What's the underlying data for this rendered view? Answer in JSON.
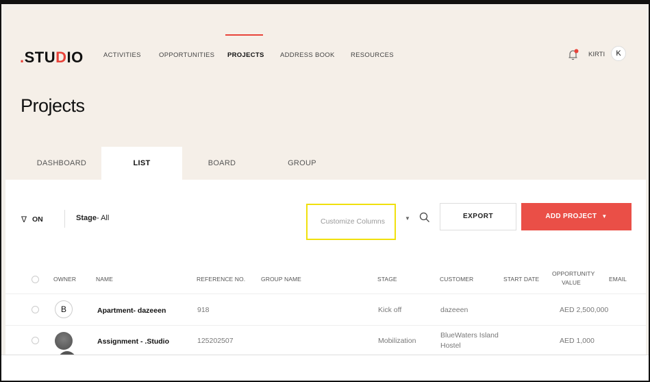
{
  "app": {
    "logo": ".STUDIO"
  },
  "nav": {
    "items": [
      "ACTIVITIES",
      "OPPORTUNITIES",
      "PROJECTS",
      "ADDRESS BOOK",
      "RESOURCES"
    ],
    "active": "PROJECTS"
  },
  "user": {
    "name": "KIRTI",
    "initial": "K"
  },
  "page": {
    "title": "Projects"
  },
  "tabs": [
    "DASHBOARD",
    "LIST",
    "BOARD",
    "GROUP"
  ],
  "toolbar": {
    "filter_label": "ON",
    "stage_label": "Stage",
    "stage_value": "- All",
    "customize_label": "Customize Columns",
    "export_label": "EXPORT",
    "add_label": "ADD PROJECT"
  },
  "table": {
    "headers": {
      "owner": "OWNER",
      "name": "NAME",
      "reference": "REFERENCE NO.",
      "group": "GROUP NAME",
      "stage": "STAGE",
      "customer": "CUSTOMER",
      "start_date": "START DATE",
      "value_line1": "OPPORTUNITY",
      "value_line2": "VALUE",
      "email": "EMAIL"
    },
    "rows": [
      {
        "owner_initial": "B",
        "name": "Apartment- dazeeen",
        "reference": "918",
        "group": "",
        "stage": "Kick off",
        "customer": "dazeeen",
        "start_date": "",
        "value": "AED 2,500,000"
      },
      {
        "owner_initial": "",
        "name": "Assignment - .Studio",
        "reference": "125202507",
        "group": "",
        "stage": "Mobilization",
        "customer_line1": "BlueWaters Island",
        "customer_line2": "Hostel",
        "start_date": "",
        "value": "AED 1,000"
      }
    ]
  },
  "colors": {
    "accent": "#ea4f47",
    "highlight": "#f0e00c",
    "header_bg": "#f5efe8"
  },
  "icons": [
    "filter-icon",
    "search-icon",
    "bell-icon",
    "caret-down-icon"
  ]
}
